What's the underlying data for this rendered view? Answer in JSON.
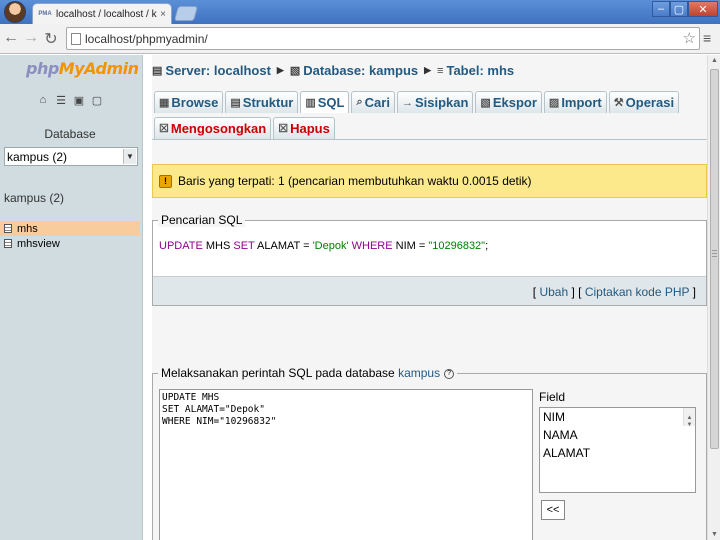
{
  "browser": {
    "tab_title": "localhost / localhost / kampus",
    "tab_favicon": "PMA",
    "tab_close": "×",
    "url": "localhost/phpmyadmin/",
    "window_buttons": [
      "–",
      "▢",
      "✕"
    ]
  },
  "sidebar": {
    "logo_php": "php",
    "logo_my": "My",
    "logo_admin": "Admin",
    "database_label": "Database",
    "selected_db": "kampus (2)",
    "db_heading": "kampus (2)",
    "tables": [
      {
        "name": "mhs",
        "active": true
      },
      {
        "name": "mhsview",
        "active": false
      }
    ]
  },
  "breadcrumb": {
    "server": "Server: localhost",
    "database": "Database: kampus",
    "table": "Tabel: mhs"
  },
  "tabs_row1": [
    {
      "label": "Browse",
      "icon": "browse-icon"
    },
    {
      "label": "Struktur",
      "icon": "structure-icon"
    },
    {
      "label": "SQL",
      "icon": "sql-icon",
      "active": true
    },
    {
      "label": "Cari",
      "icon": "search-icon"
    },
    {
      "label": "Sisipkan",
      "icon": "insert-icon"
    },
    {
      "label": "Ekspor",
      "icon": "export-icon"
    },
    {
      "label": "Import",
      "icon": "import-icon"
    },
    {
      "label": "Operasi",
      "icon": "operations-icon"
    }
  ],
  "tabs_row2": [
    {
      "label": "Mengosongkan",
      "icon": "empty-icon"
    },
    {
      "label": "Hapus",
      "icon": "drop-icon"
    }
  ],
  "notice": {
    "text": "Baris yang terpati: 1 (pencarian membutuhkan waktu 0.0015 detik)"
  },
  "sql_result": {
    "legend": "Pencarian SQL",
    "kw_update": "UPDATE",
    "table": " MHS ",
    "kw_set": "SET",
    "set_expr": " ALAMAT = ",
    "set_val": "'Depok'",
    "kw_where": " WHERE",
    "where_expr": " NIM = ",
    "where_val": "\"10296832\"",
    "end": ";",
    "link_edit": "Ubah",
    "link_php": "Ciptakan kode PHP"
  },
  "run_sql": {
    "legend_prefix": "Melaksanakan perintah SQL pada database ",
    "legend_db": "kampus",
    "query": "UPDATE MHS\nSET ALAMAT=\"Depok\"\nWHERE NIM=\"10296832\"",
    "field_label": "Field",
    "fields": [
      "NIM",
      "NAMA",
      "ALAMAT"
    ],
    "insert_button": "<<"
  }
}
